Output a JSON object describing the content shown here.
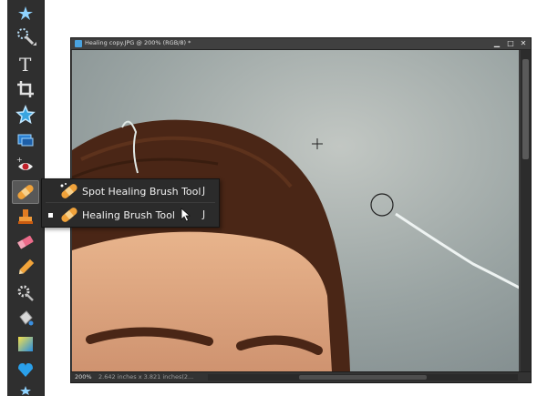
{
  "toolbox": {
    "tools": [
      {
        "name": "magic-wand-icon"
      },
      {
        "name": "quick-selection-icon"
      },
      {
        "name": "type-icon"
      },
      {
        "name": "crop-icon"
      },
      {
        "name": "cookie-cutter-icon"
      },
      {
        "name": "straighten-icon"
      },
      {
        "name": "red-eye-icon"
      },
      {
        "name": "healing-brush-icon",
        "active": true
      },
      {
        "name": "clone-stamp-icon"
      },
      {
        "name": "eraser-icon"
      },
      {
        "name": "pencil-icon"
      },
      {
        "name": "smart-brush-icon"
      },
      {
        "name": "paint-bucket-icon"
      },
      {
        "name": "gradient-icon"
      },
      {
        "name": "custom-shape-icon"
      }
    ]
  },
  "document": {
    "title": "Healing copy.JPG @ 200% (RGB/8) *",
    "minimize": "▁",
    "maximize": "□",
    "close": "✕",
    "zoom": "200%",
    "size": "2.642 inches x 3.821 inches(2..."
  },
  "flyout": {
    "items": [
      {
        "label": "Spot Healing Brush Tool",
        "key": "J",
        "selected": false
      },
      {
        "label": "Healing Brush Tool",
        "key": "J",
        "selected": true
      }
    ]
  },
  "colors": {
    "toolbox_bg": "#2f2f2f",
    "sky": "#9aa3a3",
    "hair": "#4a2a1a",
    "skin": "#d8a07a"
  }
}
